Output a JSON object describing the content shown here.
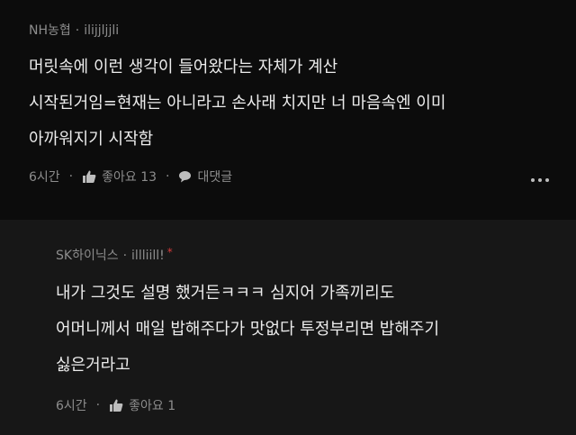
{
  "comments": [
    {
      "org": "NH농협",
      "separator": "·",
      "username": "ilijjljjli",
      "lines": [
        "머릿속에 이런 생각이 들어왔다는 자체가 계산",
        "시작된거임=현재는 아니라고 손사래 치지만 너 마음속엔 이미",
        "아까워지기 시작함"
      ],
      "time": "6시간",
      "like_label": "좋아요 13",
      "reply_label": "대댓글",
      "more_icon": "more-horizontal-icon"
    },
    {
      "org": "SK하이닉스",
      "separator": "·",
      "username": "illliill!",
      "badge": "*",
      "lines": [
        "내가 그것도 설명 했거든ㅋㅋㅋ 심지어 가족끼리도",
        "어머니께서 매일 밥해주다가 맛없다 투정부리면 밥해주기",
        "싫은거라고"
      ],
      "time": "6시간",
      "like_label": "좋아요 1"
    }
  ],
  "colors": {
    "background": "#0c0c0c",
    "reply_background": "#171717",
    "meta_text": "#8d8d8d",
    "body_text": "#ececec",
    "badge": "#d63b3b"
  }
}
